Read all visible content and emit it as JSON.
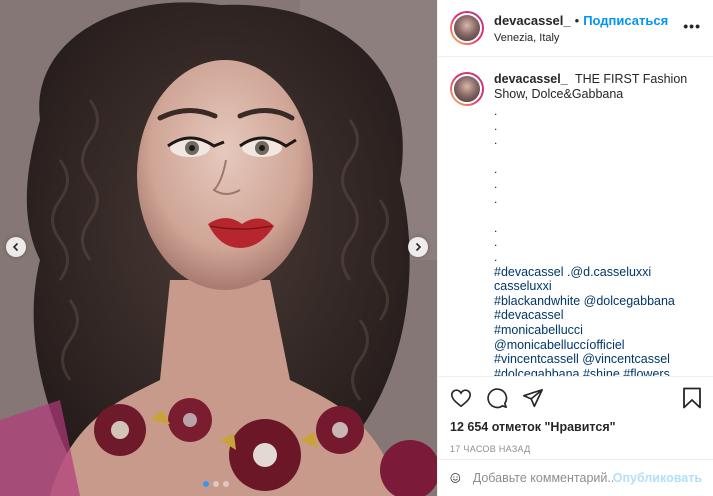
{
  "post": {
    "username": "devacassel_",
    "separator": "•",
    "follow_label": "Подписаться",
    "location": "Venezia, Italy",
    "more_label": "•••"
  },
  "caption": {
    "username": "devacassel_",
    "text": "THE FIRST Fashion Show, Dolce&Gabbana",
    "dot_lines": [
      ".",
      ".",
      ".",
      "",
      ".",
      ".",
      ".",
      "",
      ".",
      ".",
      "."
    ],
    "hashtags": [
      "#devacassel .@d.casseluxxi casseluxxi",
      "#blackandwhite @dolcegabbana",
      "#devacassel",
      "#monicabellucci",
      "@monicabelluccíofficiel",
      "#vincentcassell @vincentcassel",
      "#dolcegabbana #shine #flowers"
    ]
  },
  "actions": {
    "likes_text": "12 654 отметок \"Нравится\"",
    "time_text": "17 часов назад"
  },
  "comment_box": {
    "placeholder": "Добавьте комментарий...",
    "publish_label": "Опубликовать"
  },
  "carousel": {
    "slide_count": 3,
    "active_index": 0
  },
  "icons": {
    "nav_left": "chevron-left-icon",
    "nav_right": "chevron-right-icon",
    "like": "heart-icon",
    "comment": "comment-icon",
    "share": "share-icon",
    "save": "bookmark-icon",
    "emoji": "emoji-icon"
  },
  "colors": {
    "link": "#0095f6",
    "hashtag": "#00376b",
    "muted": "#8e8e8e",
    "publish_disabled": "#b2dffc",
    "active_dot": "#3897f0"
  }
}
